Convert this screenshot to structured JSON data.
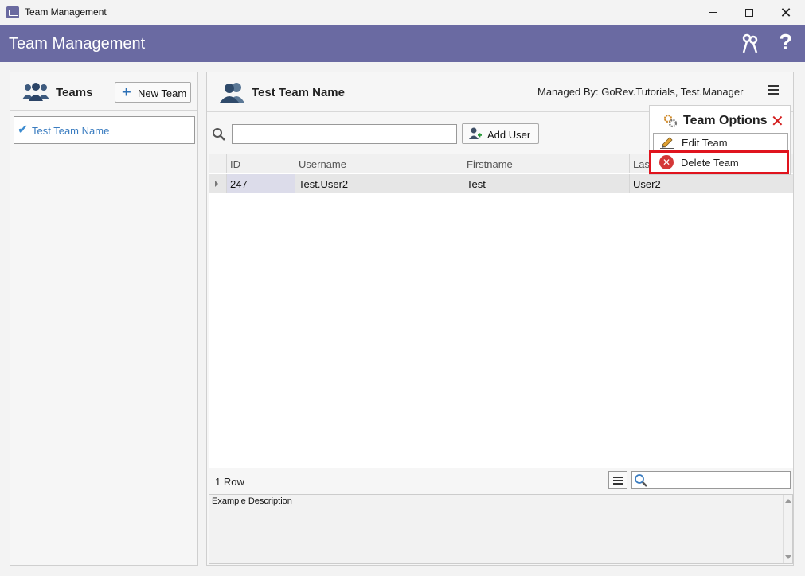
{
  "window": {
    "title": "Team Management",
    "minimize_icon": "minimize-icon",
    "maximize_icon": "maximize-icon",
    "close_label": "✕"
  },
  "header": {
    "title": "Team Management",
    "help_label": "?"
  },
  "teams_panel": {
    "title": "Teams",
    "new_team_label": "New Team",
    "items": [
      {
        "label": "Test Team Name",
        "selected": true
      }
    ]
  },
  "team_panel": {
    "title": "Test Team Name",
    "managed_by": "Managed By: GoRev.Tutorials, Test.Manager",
    "search": {
      "value": "",
      "placeholder": ""
    },
    "add_user_label": "Add User",
    "columns": [
      "ID",
      "Username",
      "Firstname",
      "Last"
    ],
    "rows": [
      {
        "id": "247",
        "username": "Test.User2",
        "firstname": "Test",
        "lastname": "User2"
      }
    ],
    "row_count": "1 Row",
    "description": "Example Description"
  },
  "team_options": {
    "title": "Team Options",
    "close_label": "✕",
    "edit_label": "Edit Team",
    "delete_label": "Delete Team"
  },
  "colors": {
    "header_bg": "#6a6aa2",
    "accent_blue": "#3a7cc0",
    "highlight_red": "#e0141e",
    "delete_red": "#d43737"
  }
}
